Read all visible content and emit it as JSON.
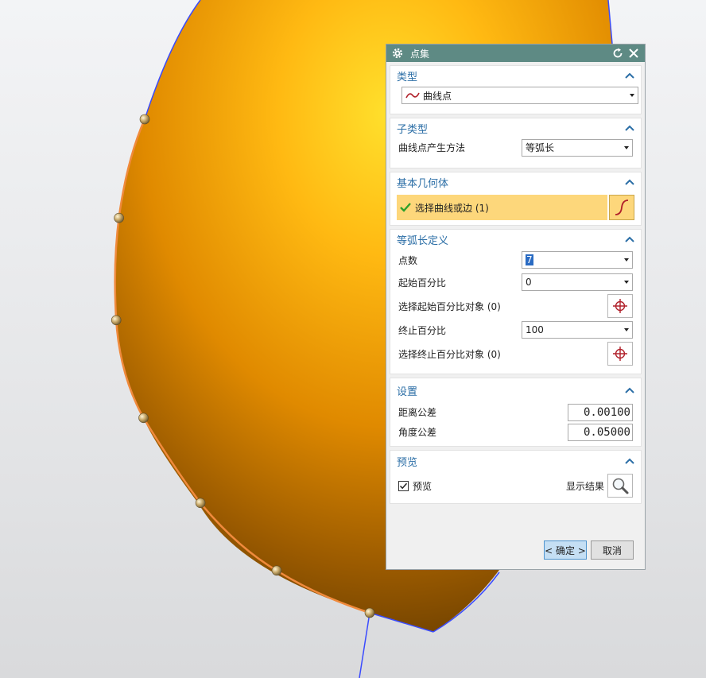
{
  "dialog": {
    "title": "点集",
    "sections": {
      "type": {
        "heading": "类型",
        "selected": "曲线点"
      },
      "subtype": {
        "heading": "子类型",
        "method_label": "曲线点产生方法",
        "method_value": "等弧长"
      },
      "geometry": {
        "heading": "基本几何体",
        "select_label": "选择曲线或边 (1)"
      },
      "arc_def": {
        "heading": "等弧长定义",
        "points_label": "点数",
        "points_value": "7",
        "start_pct_label": "起始百分比",
        "start_pct_value": "0",
        "select_start_label": "选择起始百分比对象 (0)",
        "end_pct_label": "终止百分比",
        "end_pct_value": "100",
        "select_end_label": "选择终止百分比对象 (0)"
      },
      "settings": {
        "heading": "设置",
        "dist_tol_label": "距离公差",
        "dist_tol_value": "0.00100",
        "angle_tol_label": "角度公差",
        "angle_tol_value": "0.05000"
      },
      "preview": {
        "heading": "预览",
        "checkbox_label": "预览",
        "checked": true,
        "show_result_label": "显示结果"
      }
    },
    "buttons": {
      "ok": "< 确定 >",
      "cancel": "取消"
    }
  },
  "model": {
    "point_count": 7
  },
  "colors": {
    "titlebar": "#5e8a84",
    "heading": "#2b6ea6",
    "selection": "#fdd77b",
    "surface_light": "#ffd84a",
    "surface_dark": "#6d3f00",
    "edge_highlight": "#f08a3c",
    "edge_curve": "#3a4bff"
  }
}
